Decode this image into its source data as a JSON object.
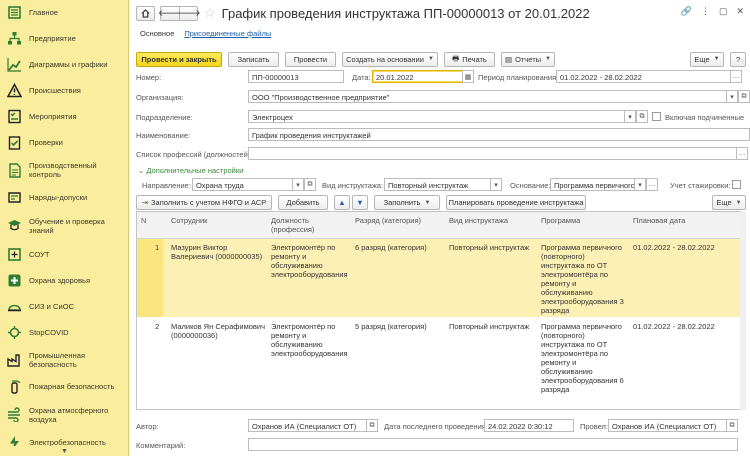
{
  "sidebar": {
    "items": [
      {
        "label": "Главное",
        "icon": "list-icon"
      },
      {
        "label": "Предприятие",
        "icon": "org-structure-icon"
      },
      {
        "label": "Диаграммы и графики",
        "icon": "chart-icon"
      },
      {
        "label": "Происшествия",
        "icon": "warning-icon"
      },
      {
        "label": "Мероприятия",
        "icon": "checklist-icon"
      },
      {
        "label": "Проверки",
        "icon": "clipboard-check-icon"
      },
      {
        "label": "Производственный контроль",
        "icon": "document-icon"
      },
      {
        "label": "Наряды-допуски",
        "icon": "permit-icon"
      },
      {
        "label": "Обучение и проверка знаний",
        "icon": "training-icon"
      },
      {
        "label": "СОУТ",
        "icon": "workplace-icon"
      },
      {
        "label": "Охрана здоровья",
        "icon": "medical-cross-icon"
      },
      {
        "label": "СИЗ и СиОС",
        "icon": "helmet-icon"
      },
      {
        "label": "StopCOVID",
        "icon": "virus-icon"
      },
      {
        "label": "Промышленная безопасность",
        "icon": "factory-icon"
      },
      {
        "label": "Пожарная безопасность",
        "icon": "fire-extinguisher-icon"
      },
      {
        "label": "Охрана атмосферного воздуха",
        "icon": "air-icon"
      },
      {
        "label": "Электробезопасность",
        "icon": "lightning-icon"
      }
    ],
    "scroll_label": "▼"
  },
  "header": {
    "title": "График проведения инструктажа ПП-00000013 от 20.01.2022",
    "tabs": [
      "Основное",
      "Присоединенные файлы"
    ]
  },
  "toolbar": {
    "post_close": "Провести и закрыть",
    "save": "Записать",
    "post": "Провести",
    "create_based": "Создать на основании",
    "print": "Печать",
    "reports": "Отчеты",
    "more": "Еще",
    "help": "?"
  },
  "form": {
    "number_label": "Номер:",
    "number": "ПП-00000013",
    "date_label": "Дата:",
    "date": "20.01.2022",
    "period_label": "Период планирования:",
    "period": "01.02.2022 - 28.02.2022",
    "org_label": "Организация:",
    "org": "ООО \"Производственное предприятие\"",
    "dept_label": "Подразделение:",
    "dept": "Электроцех",
    "include_sub_label": "Включая подчиненные",
    "name_label": "Наименование:",
    "name": "График проведения инструктажей",
    "professions_label": "Список профессий (должностей):",
    "professions": ""
  },
  "additional": {
    "section_label": "Дополнительные настройки",
    "direction_label": "Направление:",
    "direction": "Охрана труда",
    "briefing_type_label": "Вид инструктажа:",
    "briefing_type": "Повторный инструктаж",
    "basis_label": "Основание:",
    "basis": "Программа первичного",
    "internship_label": "Учет стажировки:"
  },
  "table_toolbar": {
    "fill_nfgo": "Заполнить с учетом НФГО и АСР",
    "add": "Добавить",
    "fill": "Заполнить",
    "plan": "Планировать проведение инструктажа",
    "more": "Еще"
  },
  "table": {
    "columns": [
      "N",
      "Сотрудник",
      "Должность (профессия)",
      "Разряд (категория)",
      "Вид инструктажа",
      "Программа",
      "Плановая дата"
    ],
    "rows": [
      {
        "n": "1",
        "employee": "Мазурин Виктор Валериевич (0000000035)",
        "position": "Электромонтёр по ремонту и обслуживанию электрооборудования",
        "grade": "6 разряд (категория)",
        "type": "Повторный инструктаж",
        "program": "Программа первичного (повторного) инструктажа по ОТ электромонтёра по ремонту и обслуживанию электрооборудования 3 разряда",
        "date": "01.02.2022 - 28.02.2022"
      },
      {
        "n": "2",
        "employee": "Маликов Ян Серафимович (0000000036)",
        "position": "Электромонтёр по ремонту и обслуживанию электрооборудования",
        "grade": "5 разряд (категория)",
        "type": "Повторный инструктаж",
        "program": "Программа первичного (повторного) инструктажа по ОТ электромонтёра по ремонту и обслуживанию электрооборудования 6 разряда",
        "date": "01.02.2022 - 28.02.2022"
      }
    ]
  },
  "footer": {
    "author_label": "Автор:",
    "author": "Охранов ИА (Специалист ОТ)",
    "last_date_label": "Дата последнего проведения:",
    "last_date": "24.02.2022  0:30:12",
    "posted_label": "Провел:",
    "posted": "Охранов ИА (Специалист ОТ)",
    "comment_label": "Комментарий:",
    "comment": ""
  },
  "colors": {
    "sidebar_bg": "#fbed9e",
    "primary_button": "#f5d51e",
    "selected_row": "#fdf0b5",
    "icon_green": "#2e7d32",
    "link": "#1f5fa8"
  }
}
